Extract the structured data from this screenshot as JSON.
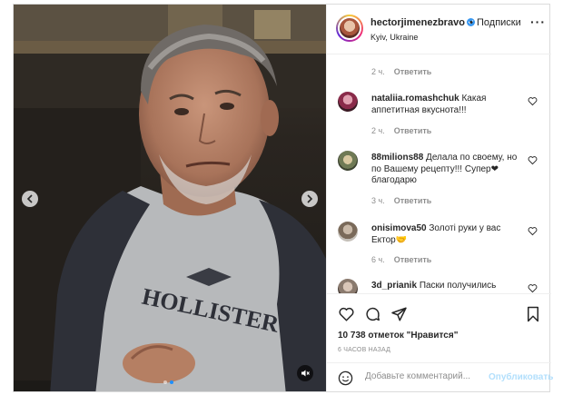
{
  "post": {
    "author": {
      "username": "hectorjimenezbravo",
      "verified": true,
      "separator": "•",
      "follow_label": "Подписки",
      "location": "Kyiv, Ukraine"
    },
    "more_icon": "more-horizontal-icon",
    "media": {
      "prev_icon": "chevron-left-icon",
      "next_icon": "chevron-right-icon",
      "mute_icon": "speaker-muted-icon",
      "slides": 2,
      "active_slide": 2
    },
    "comments": {
      "top_meta": {
        "time": "2 ч.",
        "reply": "Ответить"
      },
      "items": [
        {
          "username": "nataliia.romashchuk",
          "text": "Какая аппетитная вкуснота!!!",
          "time": "2 ч.",
          "reply": "Ответить"
        },
        {
          "username": "88milions88",
          "text": "Делала по своему, но по Вашему рецепту!!! Супер❤ благодарю",
          "time": "3 ч.",
          "reply": "Ответить"
        },
        {
          "username": "onisimova50",
          "text": "Золоті руки у вас Ектор🤝",
          "time": "6 ч.",
          "reply": "Ответить"
        },
        {
          "username": "3d_prianik",
          "text": "Паски получились"
        }
      ]
    },
    "actions": {
      "icons": [
        "heart-icon",
        "comment-bubble-icon",
        "share-plane-icon",
        "bookmark-icon"
      ],
      "likes_text": "10 738 отметок \"Нравится\"",
      "time_ago": "6 ЧАСОВ НАЗАД"
    },
    "add_comment": {
      "emoji_icon": "smiley-icon",
      "placeholder": "Добавьте комментарий...",
      "publish_label": "Опубликовать"
    },
    "colors": {
      "link_disabled": "#b2dffc",
      "verified": "#3897f0",
      "meta": "#8e8e8e",
      "text": "#262626"
    }
  }
}
